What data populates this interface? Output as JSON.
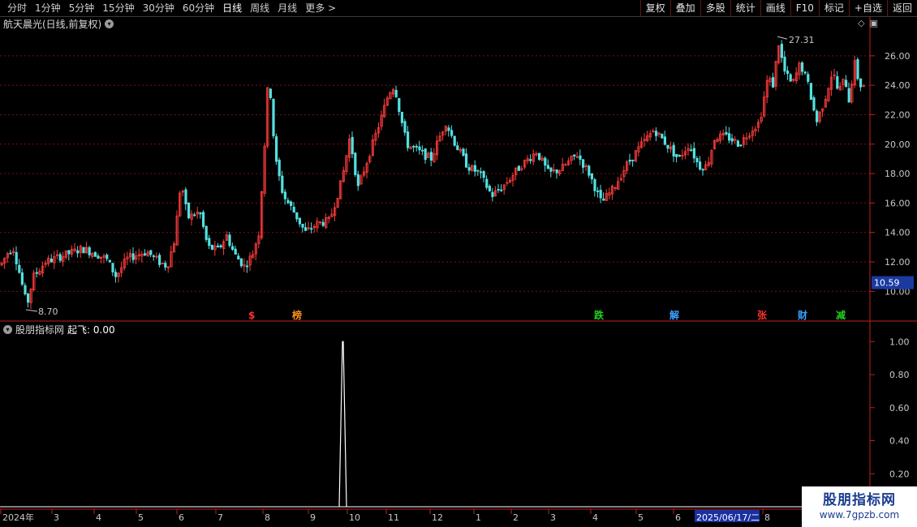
{
  "toolbar": {
    "periods": [
      "分时",
      "1分钟",
      "5分钟",
      "15分钟",
      "30分钟",
      "60分钟",
      "日线",
      "周线",
      "月线",
      "更多 >"
    ],
    "active_period": "日线",
    "tools": [
      "复权",
      "叠加",
      "多股",
      "统计",
      "画线",
      "F10",
      "标记",
      "+自选",
      "返回"
    ]
  },
  "main_chart": {
    "title": "航天晨光(日线,前复权)",
    "icons": [
      "diamond-icon",
      "split-icon"
    ],
    "price_axis": [
      "26.00",
      "24.00",
      "22.00",
      "20.00",
      "18.00",
      "16.00",
      "14.00",
      "12.00",
      "10.00"
    ],
    "price_range": [
      8.2,
      27.7
    ],
    "current_price": "10.59",
    "high_label": "27.31",
    "low_label": "8.70",
    "up_color": "#ff3c3c",
    "down_color": "#54e0e0",
    "event_markers": [
      {
        "label": "$",
        "color": "#ff3030"
      },
      {
        "label": "榜",
        "color": "#ff9020"
      },
      {
        "label": "跌",
        "color": "#20d020"
      },
      {
        "label": "解",
        "color": "#3aa0ff"
      },
      {
        "label": "张",
        "color": "#ff3030"
      },
      {
        "label": "财",
        "color": "#3aa0ff"
      },
      {
        "label": "减",
        "color": "#20d020"
      }
    ]
  },
  "sub_chart": {
    "title": "股朋指标网",
    "indicator": "起飞: 0.00",
    "axis": [
      "1.00",
      "0.80",
      "0.60",
      "0.40",
      "0.20"
    ]
  },
  "time_axis": [
    "2024年",
    "3",
    "4",
    "5",
    "6",
    "7",
    "8",
    "9",
    "10",
    "11",
    "12",
    "1",
    "2",
    "3",
    "4",
    "5",
    "6",
    "2025/06/17/二",
    "8"
  ],
  "watermark": {
    "title": "股朋指标网",
    "url": "www.7gpzb.com"
  },
  "chart_data": {
    "type": "candlestick",
    "anchors": [
      [
        0,
        11.8
      ],
      [
        8,
        12.6
      ],
      [
        15,
        13.0
      ],
      [
        24,
        11.0
      ],
      [
        32,
        9.0
      ],
      [
        40,
        11.0
      ],
      [
        55,
        12.0
      ],
      [
        70,
        12.3
      ],
      [
        85,
        12.6
      ],
      [
        100,
        12.9
      ],
      [
        115,
        12.6
      ],
      [
        130,
        12.2
      ],
      [
        142,
        11.0
      ],
      [
        155,
        12.2
      ],
      [
        168,
        12.5
      ],
      [
        180,
        12.7
      ],
      [
        195,
        12.0
      ],
      [
        205,
        11.7
      ],
      [
        214,
        13.5
      ],
      [
        222,
        17.5
      ],
      [
        230,
        15.0
      ],
      [
        245,
        15.4
      ],
      [
        255,
        13.0
      ],
      [
        268,
        12.8
      ],
      [
        278,
        13.8
      ],
      [
        288,
        12.5
      ],
      [
        300,
        11.7
      ],
      [
        310,
        12.5
      ],
      [
        318,
        14.0
      ],
      [
        325,
        20.0
      ],
      [
        330,
        25.0
      ],
      [
        338,
        19.0
      ],
      [
        348,
        16.5
      ],
      [
        360,
        15.5
      ],
      [
        375,
        14.0
      ],
      [
        390,
        14.6
      ],
      [
        405,
        14.8
      ],
      [
        420,
        17.5
      ],
      [
        430,
        20.5
      ],
      [
        440,
        17.0
      ],
      [
        455,
        19.5
      ],
      [
        470,
        22.0
      ],
      [
        478,
        23.5
      ],
      [
        485,
        24.0
      ],
      [
        492,
        22.0
      ],
      [
        500,
        20.0
      ],
      [
        515,
        19.5
      ],
      [
        530,
        19.0
      ],
      [
        548,
        21.5
      ],
      [
        560,
        20.0
      ],
      [
        575,
        18.5
      ],
      [
        590,
        18.0
      ],
      [
        605,
        16.5
      ],
      [
        620,
        17.2
      ],
      [
        640,
        18.5
      ],
      [
        660,
        19.5
      ],
      [
        675,
        18.0
      ],
      [
        690,
        18.3
      ],
      [
        710,
        19.3
      ],
      [
        725,
        18.0
      ],
      [
        740,
        16.0
      ],
      [
        755,
        17.0
      ],
      [
        770,
        18.5
      ],
      [
        790,
        20.0
      ],
      [
        805,
        21.0
      ],
      [
        820,
        20.0
      ],
      [
        835,
        19.0
      ],
      [
        848,
        20.0
      ],
      [
        860,
        18.5
      ],
      [
        870,
        18.5
      ],
      [
        880,
        20.5
      ],
      [
        895,
        20.5
      ],
      [
        910,
        20.0
      ],
      [
        925,
        21.0
      ],
      [
        935,
        21.5
      ],
      [
        945,
        24.5
      ],
      [
        952,
        24.0
      ],
      [
        958,
        27.0
      ],
      [
        965,
        25.0
      ],
      [
        975,
        24.0
      ],
      [
        985,
        25.5
      ],
      [
        995,
        24.0
      ],
      [
        1005,
        21.5
      ],
      [
        1015,
        23.0
      ],
      [
        1025,
        25.0
      ],
      [
        1032,
        23.5
      ],
      [
        1040,
        24.5
      ],
      [
        1045,
        23.0
      ],
      [
        1052,
        25.5
      ],
      [
        1058,
        24.0
      ],
      [
        1064,
        24.0
      ]
    ],
    "indicator_spike": {
      "x_index": 422,
      "value": 1.0
    },
    "sub_range": [
      0,
      1.08
    ]
  }
}
